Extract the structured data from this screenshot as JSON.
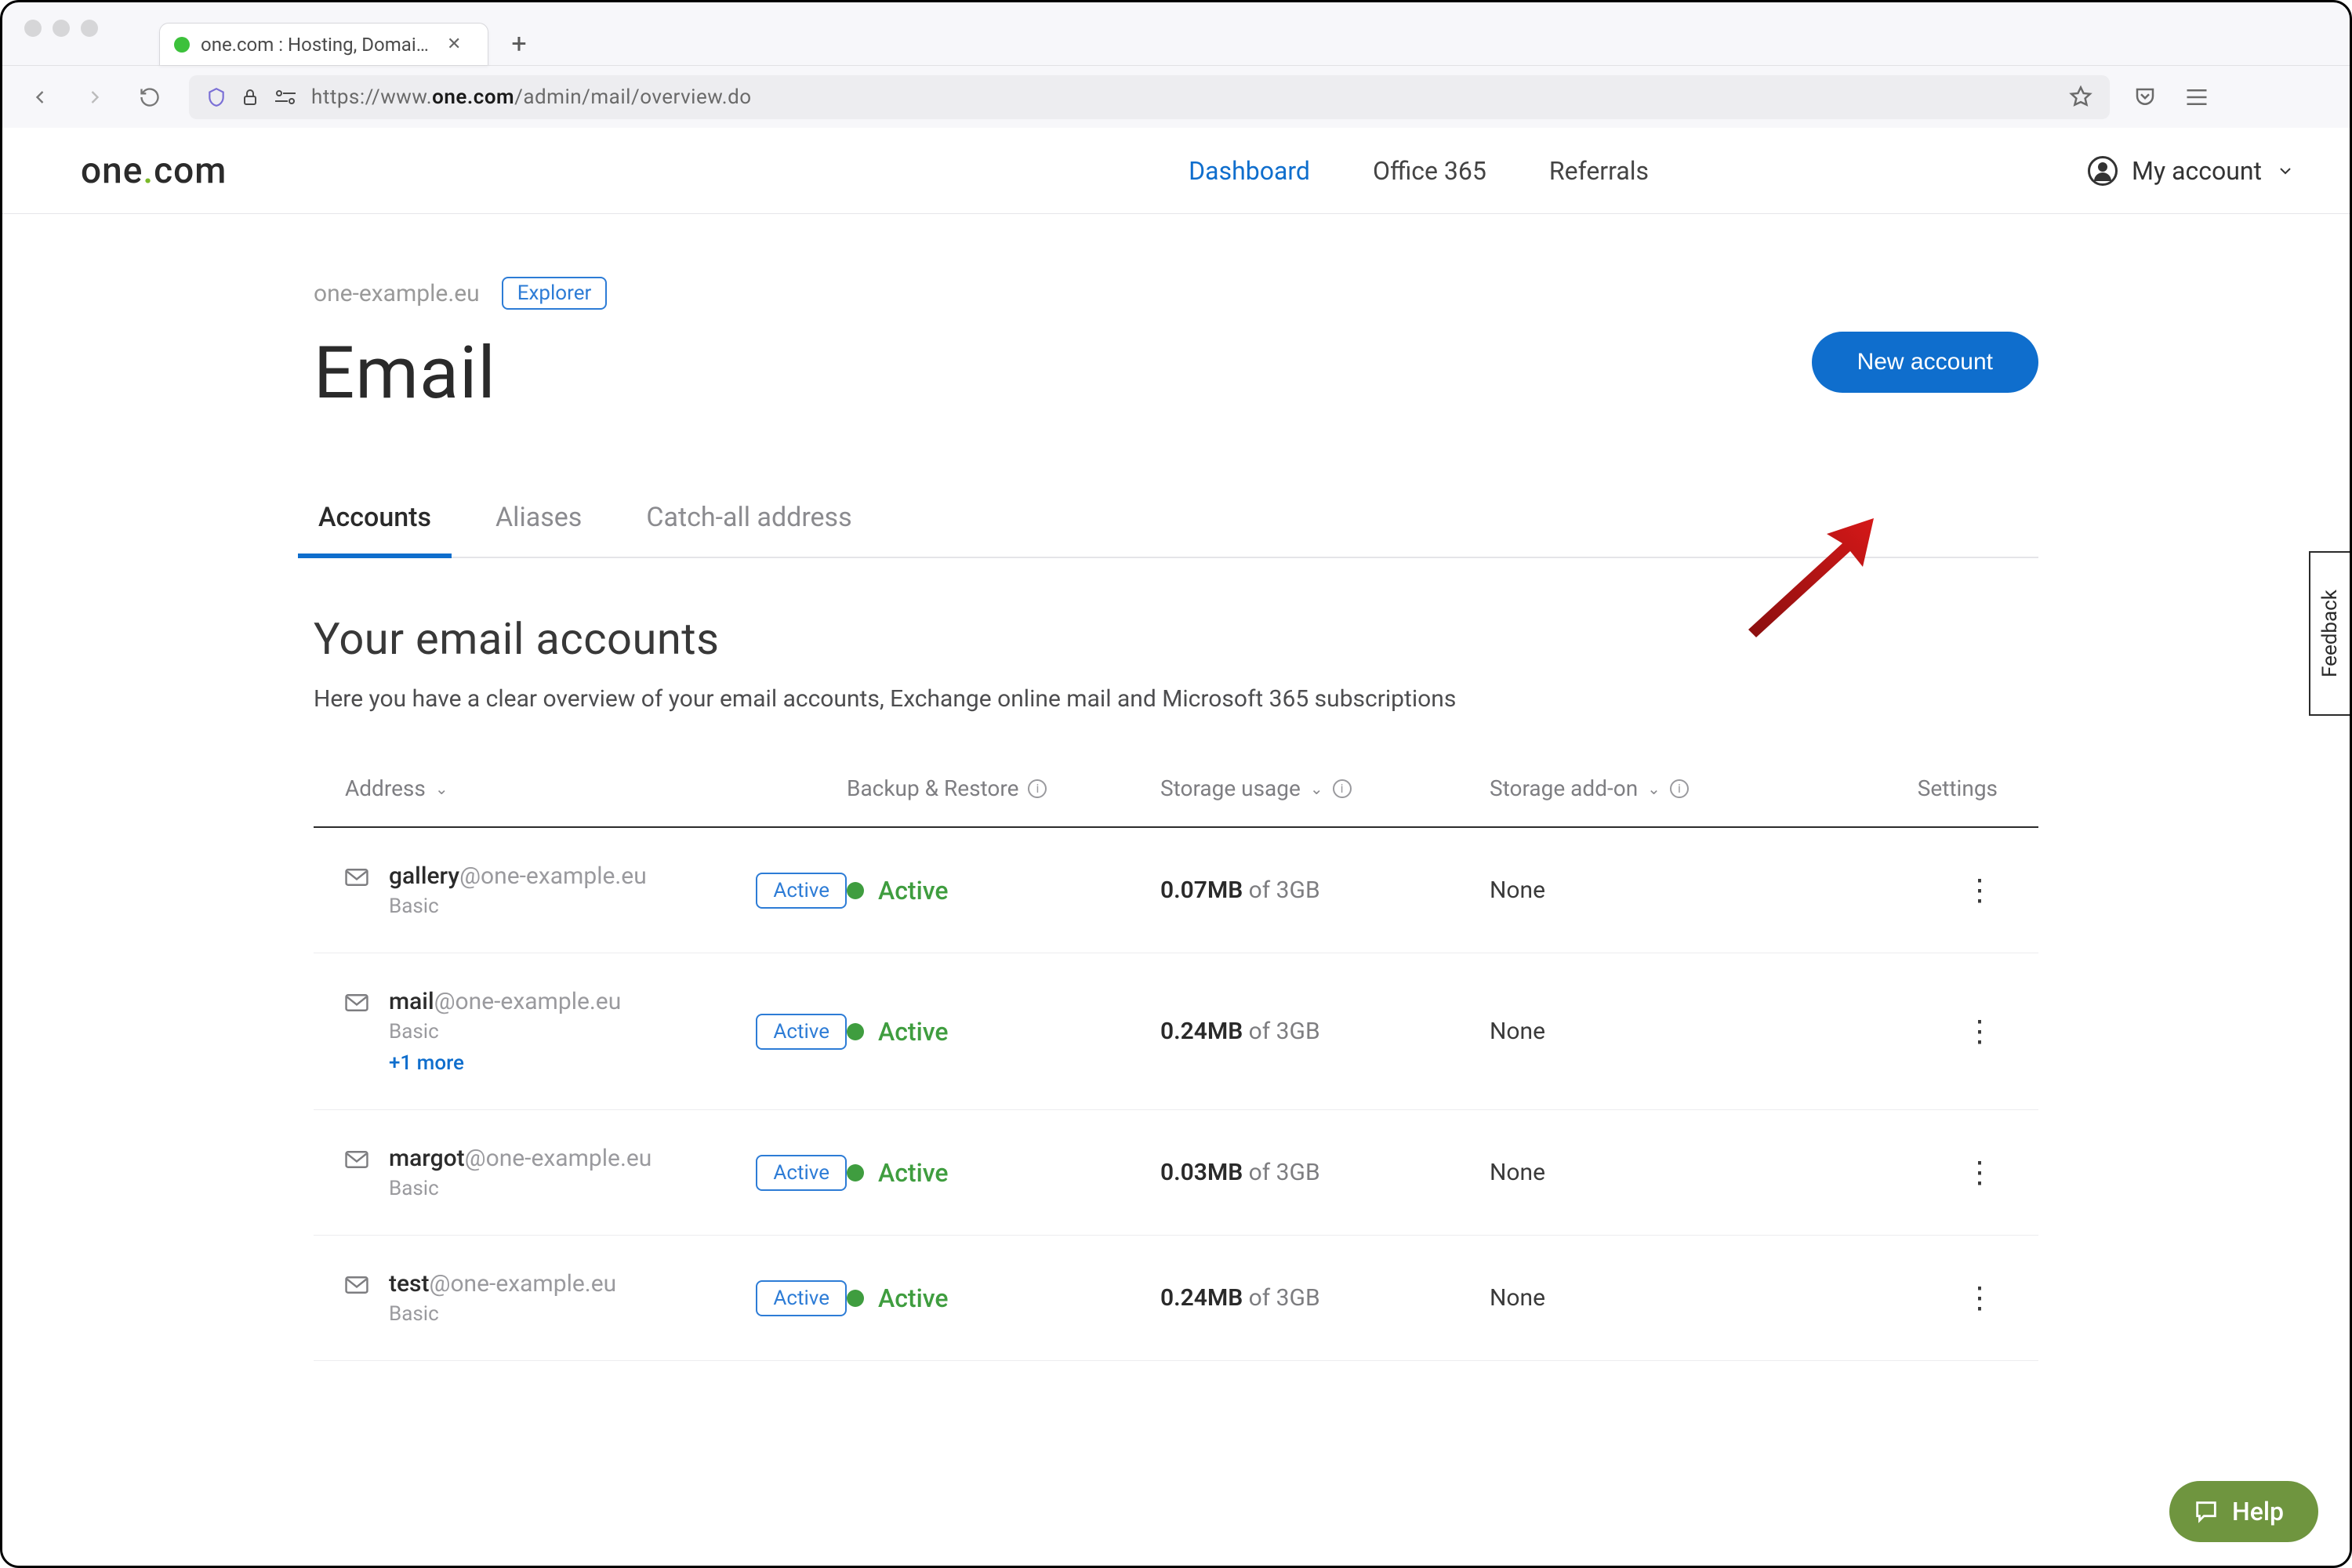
{
  "browser": {
    "tab_title": "one.com : Hosting, Domain, Email",
    "url_prefix": "https://www.",
    "url_host": "one.com",
    "url_path": "/admin/mail/overview.do"
  },
  "header": {
    "logo_pre": "one",
    "logo_post": "com",
    "nav": {
      "dashboard": "Dashboard",
      "office365": "Office 365",
      "referrals": "Referrals"
    },
    "account_label": "My account"
  },
  "crumb": {
    "domain": "one-example.eu",
    "badge": "Explorer"
  },
  "title": "Email",
  "new_account_btn": "New account",
  "subtabs": {
    "accounts": "Accounts",
    "aliases": "Aliases",
    "catchall": "Catch-all address"
  },
  "section": {
    "title": "Your email accounts",
    "subtitle": "Here you have a clear overview of your email accounts, Exchange online mail and Microsoft 365 subscriptions"
  },
  "columns": {
    "address": "Address",
    "backup": "Backup & Restore",
    "storage": "Storage usage",
    "addon": "Storage add-on",
    "settings": "Settings"
  },
  "active_pill": "Active",
  "status_active": "Active",
  "storage_of": " of ",
  "rows": [
    {
      "local": "gallery",
      "domain": "@one-example.eu",
      "plan": "Basic",
      "more": "",
      "used": "0.07MB",
      "total": "3GB",
      "addon": "None"
    },
    {
      "local": "mail",
      "domain": "@one-example.eu",
      "plan": "Basic",
      "more": "+1 more",
      "used": "0.24MB",
      "total": "3GB",
      "addon": "None"
    },
    {
      "local": "margot",
      "domain": "@one-example.eu",
      "plan": "Basic",
      "more": "",
      "used": "0.03MB",
      "total": "3GB",
      "addon": "None"
    },
    {
      "local": "test",
      "domain": "@one-example.eu",
      "plan": "Basic",
      "more": "",
      "used": "0.24MB",
      "total": "3GB",
      "addon": "None"
    }
  ],
  "feedback": "Feedback",
  "help": "Help"
}
